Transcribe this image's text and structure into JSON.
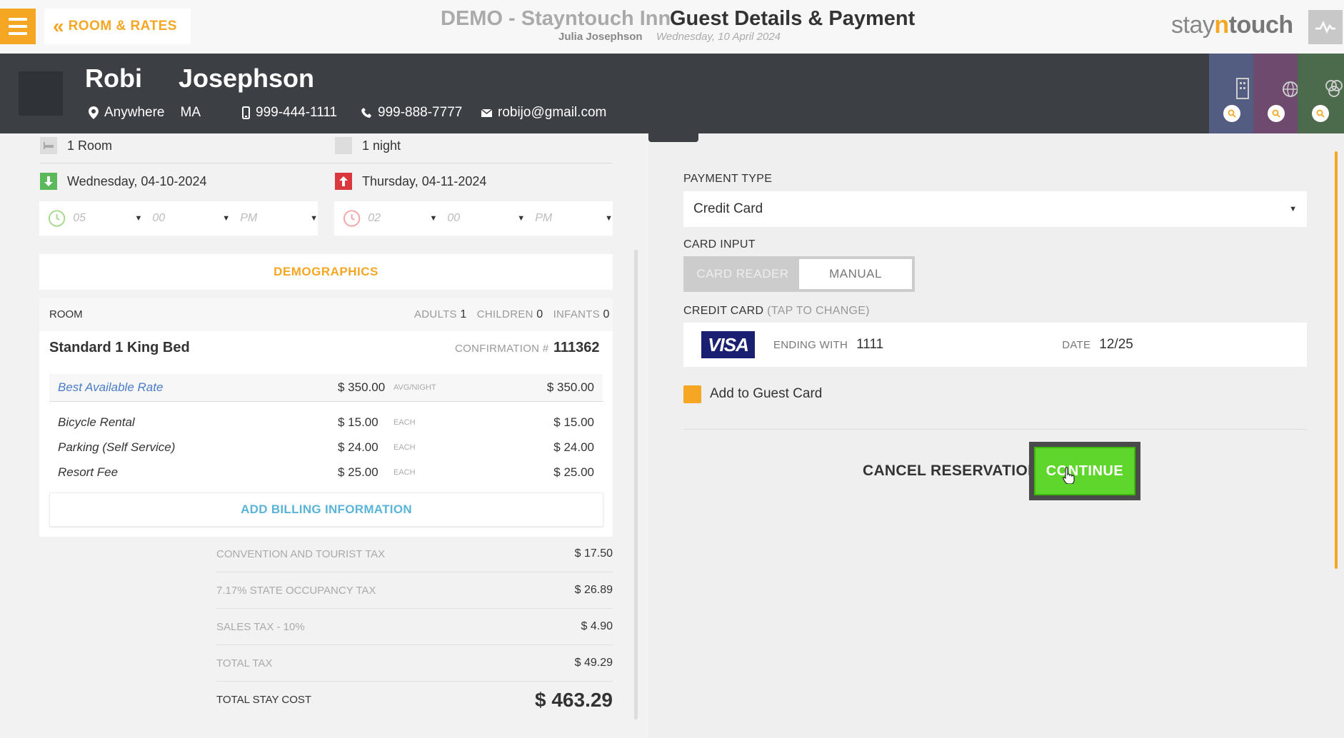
{
  "header": {
    "back_label": "ROOM & RATES",
    "hotel_name": "DEMO - Stayntouch Inn",
    "page_title": "Guest Details & Payment",
    "user": "Julia Josephson",
    "date": "Wednesday, 10 April 2024",
    "brand": {
      "stay": "stay",
      "n": "n",
      "touch": "touch"
    }
  },
  "guest": {
    "first_name": "Robi",
    "last_name": "Josephson",
    "city": "Anywhere",
    "state": "MA",
    "mobile": "999-444-1111",
    "phone": "999-888-7777",
    "email": "robijo@gmail.com"
  },
  "stay": {
    "rooms": "1 Room",
    "nights": "1 night",
    "arrival": "Wednesday, 04-10-2024",
    "departure": "Thursday, 04-11-2024",
    "arrival_time": {
      "hour": "05",
      "minute": "00",
      "ampm": "PM"
    },
    "departure_time": {
      "hour": "02",
      "minute": "00",
      "ampm": "PM"
    }
  },
  "demographics_label": "DEMOGRAPHICS",
  "room": {
    "label": "ROOM",
    "adults_label": "ADULTS",
    "adults": "1",
    "children_label": "CHILDREN",
    "children": "0",
    "infants_label": "INFANTS",
    "infants": "0",
    "type": "Standard 1 King Bed",
    "confirmation_label": "CONFIRMATION #",
    "confirmation": "111362",
    "rate": {
      "name": "Best Available Rate",
      "price": "$ 350.00",
      "unit": "AVG/NIGHT",
      "amount": "$ 350.00"
    },
    "addons": [
      {
        "name": "Bicycle Rental",
        "price": "$ 15.00",
        "unit": "EACH",
        "amount": "$ 15.00"
      },
      {
        "name": "Parking (Self Service)",
        "price": "$ 24.00",
        "unit": "EACH",
        "amount": "$ 24.00"
      },
      {
        "name": "Resort Fee",
        "price": "$ 25.00",
        "unit": "EACH",
        "amount": "$ 25.00"
      }
    ],
    "add_billing_label": "ADD BILLING INFORMATION"
  },
  "taxes": [
    {
      "label": "CONVENTION AND TOURIST TAX",
      "value": "$ 17.50"
    },
    {
      "label": "7.17% STATE OCCUPANCY TAX",
      "value": "$ 26.89"
    },
    {
      "label": "SALES TAX - 10%",
      "value": "$ 4.90"
    },
    {
      "label": "TOTAL TAX",
      "value": "$ 49.29"
    }
  ],
  "total": {
    "label": "TOTAL STAY COST",
    "value": "$ 463.29"
  },
  "payment": {
    "type_label": "PAYMENT TYPE",
    "type_value": "Credit Card",
    "card_input_label": "CARD INPUT",
    "card_reader": "CARD READER",
    "manual": "MANUAL",
    "cc_label": "CREDIT CARD",
    "cc_hint": "(TAP TO CHANGE)",
    "card_brand": "VISA",
    "ending_label": "ENDING WITH",
    "ending": "1111",
    "date_label": "DATE",
    "date": "12/25",
    "add_to_card": "Add to Guest Card",
    "cancel": "CANCEL RESERVATION",
    "continue": "CONTINUE"
  },
  "colors": {
    "accent": "#f5a623",
    "continue": "#5fd62b",
    "header_dark": "#3c3f44",
    "tab_blue": "#535d82",
    "tab_purple": "#6e4a6e",
    "tab_green": "#4c6b4c"
  }
}
